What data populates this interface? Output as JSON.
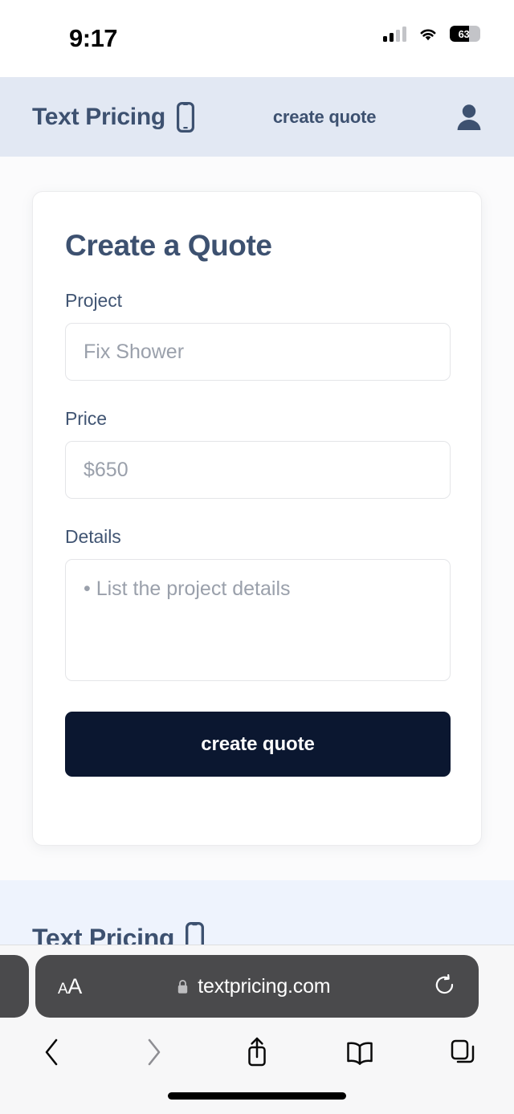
{
  "status_bar": {
    "time": "9:17",
    "cellular_icon": "cellular-signal-icon",
    "wifi_icon": "wifi-icon",
    "battery_percent": "63",
    "battery_level": 63
  },
  "site_header": {
    "brand_name": "Text Pricing",
    "brand_icon": "mobile-phone-icon",
    "nav_link": "create quote",
    "account_icon": "user-avatar-icon",
    "background_color": "#e2e8f3",
    "text_color": "#3d5170"
  },
  "card": {
    "title": "Create a Quote",
    "fields": [
      {
        "label": "Project",
        "placeholder": "Fix Shower",
        "value": "",
        "type": "text"
      },
      {
        "label": "Price",
        "placeholder": "$650",
        "value": "",
        "type": "text"
      },
      {
        "label": "Details",
        "placeholder": "• List the project details",
        "value": "",
        "type": "textarea"
      }
    ],
    "submit_label": "create quote",
    "submit_color": "#0b1730"
  },
  "site_footer": {
    "brand_name": "Text Pricing",
    "brand_icon": "mobile-phone-icon",
    "background_color": "#eef3fd"
  },
  "browser": {
    "text_size_label_small": "A",
    "text_size_label_big": "A",
    "lock_icon": "lock-icon",
    "url": "textpricing.com",
    "reload_icon": "reload-icon",
    "toolbar": [
      {
        "name": "back",
        "icon": "chevron-left-icon",
        "enabled": true
      },
      {
        "name": "forward",
        "icon": "chevron-right-icon",
        "enabled": false
      },
      {
        "name": "share",
        "icon": "share-icon",
        "enabled": true
      },
      {
        "name": "bookmarks",
        "icon": "book-icon",
        "enabled": true
      },
      {
        "name": "tabs",
        "icon": "tabs-icon",
        "enabled": true
      }
    ]
  }
}
